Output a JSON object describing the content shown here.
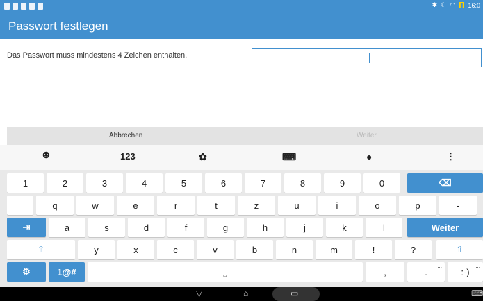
{
  "status_bar": {
    "icons_left": [
      "notification-icon",
      "notification-icon",
      "notification-icon",
      "phone-icon",
      "sd-card-icon"
    ],
    "time": "16:0",
    "icons_right": [
      "bluetooth-icon",
      "moon-icon",
      "wifi-icon",
      "battery-icon"
    ]
  },
  "dialog": {
    "title": "Passwort festlegen",
    "instruction": "Das Passwort muss mindestens 4 Zeichen enthalten.",
    "password_value": "",
    "cancel_label": "Abbrechen",
    "next_label": "Weiter"
  },
  "keyboard": {
    "toolbar": {
      "emoji_icon": "emoji-icon",
      "numbers_label": "123",
      "theme_icon": "palette-icon",
      "layout_icon": "keyboard-icon",
      "voice_icon": "microphone-icon",
      "more_label": "⋮"
    },
    "row1": [
      "1",
      "2",
      "3",
      "4",
      "5",
      "6",
      "7",
      "8",
      "9",
      "0"
    ],
    "backspace_label": "⌫",
    "row2": [
      "q",
      "w",
      "e",
      "r",
      "t",
      "z",
      "u",
      "i",
      "o",
      "p",
      "-"
    ],
    "row3": [
      "a",
      "s",
      "d",
      "f",
      "g",
      "h",
      "j",
      "k",
      "l"
    ],
    "tab_label": "⇥",
    "enter_label": "Weiter",
    "row4": [
      "y",
      "x",
      "c",
      "v",
      "b",
      "n",
      "m",
      "!",
      "?"
    ],
    "shift_label": "⇧",
    "settings_label": "⚙",
    "symbols_label": "1@#",
    "space_label": "⎵",
    "comma_label": ",",
    "period_label": ".",
    "smiley_label": ":-)",
    "hint_label": "..."
  },
  "nav_bar": {
    "back_label": "▽",
    "home_label": "⌂",
    "recents_label": "▭",
    "keyboard_label": "⌨"
  }
}
